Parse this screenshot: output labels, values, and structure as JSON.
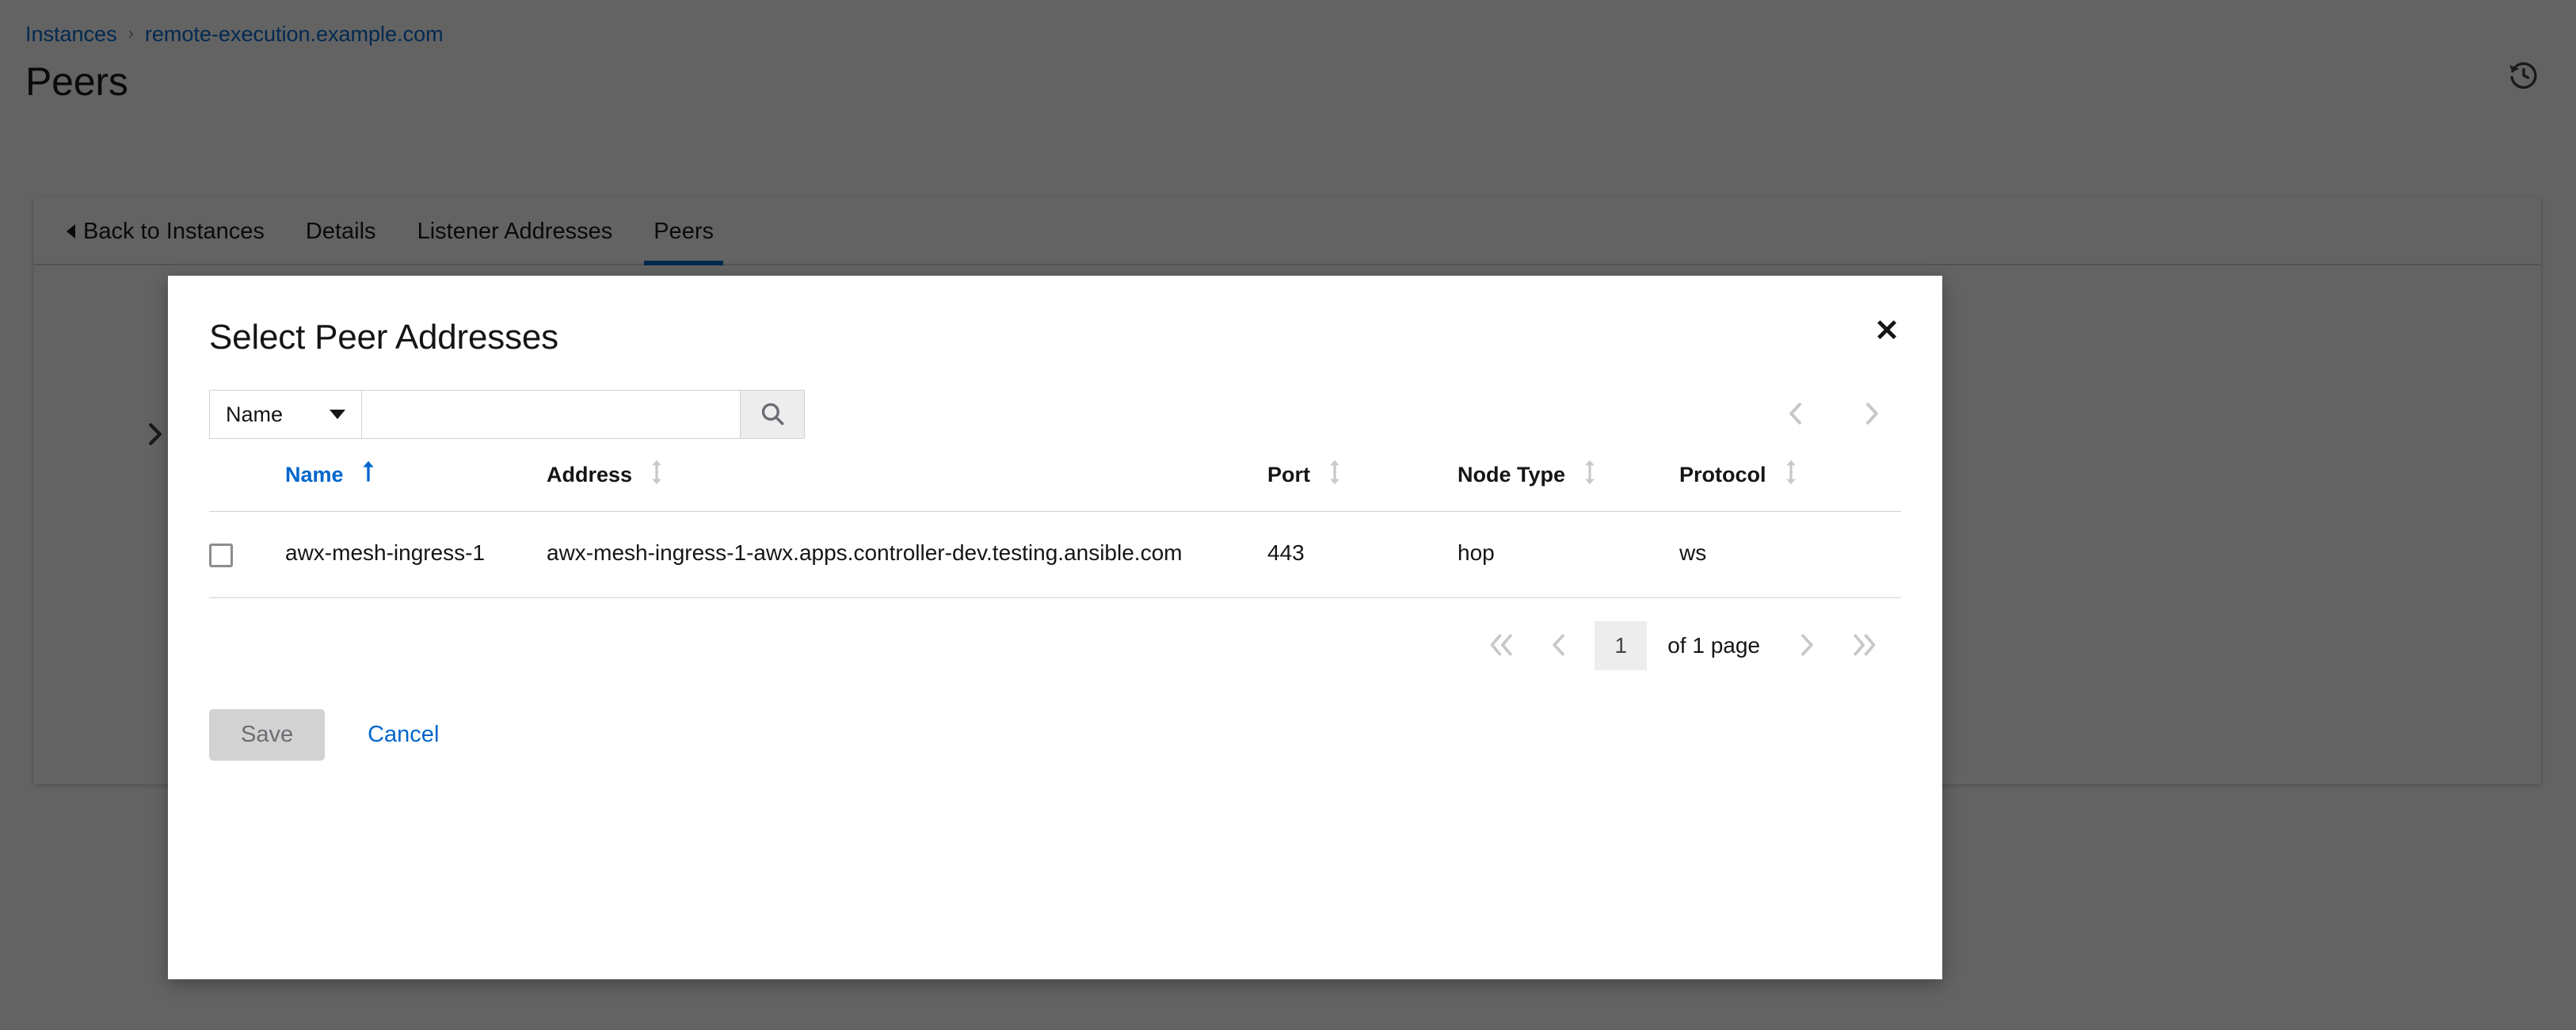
{
  "page": {
    "breadcrumb": {
      "items": [
        {
          "label": "Instances"
        },
        {
          "label": "remote-execution.example.com"
        }
      ],
      "separator": "›"
    },
    "title": "Peers",
    "history_icon": "history-icon",
    "tabs": [
      {
        "label": "Back to Instances",
        "active": false,
        "kind": "back"
      },
      {
        "label": "Details",
        "active": false
      },
      {
        "label": "Listener Addresses",
        "active": false
      },
      {
        "label": "Peers",
        "active": true
      }
    ],
    "expand_toggle_icon": "chevron-right-icon"
  },
  "modal": {
    "title": "Select Peer Addresses",
    "close_label": "✕",
    "toolbar": {
      "filter_selected": "Name",
      "filter_caret_icon": "chevron-down-icon",
      "search_value": "",
      "search_placeholder": "",
      "search_icon": "search-icon",
      "prev_icon": "‹",
      "next_icon": "›"
    },
    "table": {
      "columns": [
        {
          "key": "check",
          "label": "",
          "sortable": false,
          "sorted": false
        },
        {
          "key": "name",
          "label": "Name",
          "sortable": true,
          "sorted": true,
          "direction": "asc"
        },
        {
          "key": "address",
          "label": "Address",
          "sortable": true,
          "sorted": false
        },
        {
          "key": "port",
          "label": "Port",
          "sortable": true,
          "sorted": false
        },
        {
          "key": "nodetype",
          "label": "Node Type",
          "sortable": true,
          "sorted": false
        },
        {
          "key": "protocol",
          "label": "Protocol",
          "sortable": true,
          "sorted": false
        }
      ],
      "rows": [
        {
          "selected": false,
          "name": "awx-mesh-ingress-1",
          "address": "awx-mesh-ingress-1-awx.apps.controller-dev.testing.ansible.com",
          "port": "443",
          "node_type": "hop",
          "protocol": "ws"
        }
      ]
    },
    "pagination": {
      "first_icon": "«",
      "prev_icon": "‹",
      "current_page": "1",
      "count_label": "of 1 page",
      "next_icon": "›",
      "last_icon": "»"
    },
    "footer": {
      "save_label": "Save",
      "save_disabled": true,
      "cancel_label": "Cancel"
    }
  },
  "colors": {
    "link": "#0066cc",
    "active_tab_underline": "#0066cc",
    "backdrop": "rgba(3,3,3,0.62)",
    "border": "#d2d2d2",
    "disabled_button_bg": "#d2d2d2"
  }
}
